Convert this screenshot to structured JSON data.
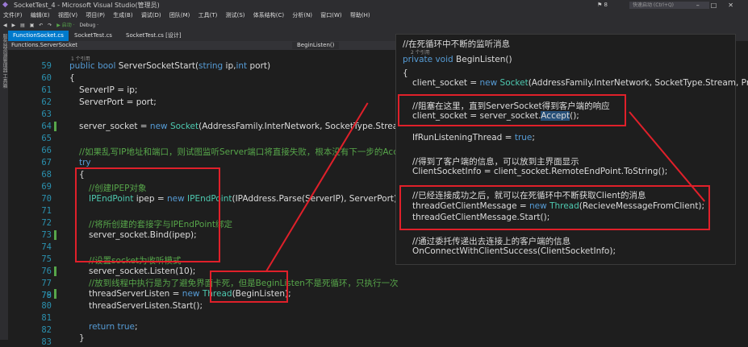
{
  "titlebar": {
    "title": "SocketTest_4 - Microsoft Visual Studio(管理员)",
    "quick_launch": "快速启动 (Ctrl+Q)",
    "notifications": "8"
  },
  "menu": [
    "文件(F)",
    "编辑(E)",
    "视图(V)",
    "项目(P)",
    "生成(B)",
    "调试(D)",
    "团队(M)",
    "工具(T)",
    "测试(S)",
    "体系结构(C)",
    "分析(N)",
    "窗口(W)",
    "帮助(H)"
  ],
  "toolbar": {
    "start": "▶ 启动 ·",
    "config": "Debug ·"
  },
  "side_panel": "服务器资源管理器 工具箱",
  "tabs": [
    "FunctionSocket.cs",
    "SocketTest.cs",
    "SocketTest.cs [设计]"
  ],
  "navbar": {
    "left": "Functions.ServerSocket",
    "right": "BeginListen()"
  },
  "editor": {
    "refs": "1 个引用",
    "lines": [
      {
        "n": "59",
        "k": "public",
        "k2": "bool",
        "rest": " ServerSocketStart(",
        "t": "string",
        "rest2": " ip,",
        "t2": "int",
        "rest3": " port)"
      },
      {
        "n": "60",
        "text": "{"
      },
      {
        "n": "61",
        "text": "ServerIP = ip;"
      },
      {
        "n": "62",
        "text": "ServerPort = port;"
      },
      {
        "n": "63",
        "text": ""
      },
      {
        "n": "64",
        "pre": "server_socket = ",
        "k": "new",
        "t": " Socket",
        "rest": "(AddressFamily.InterNetwork, SocketType.Stream, P"
      },
      {
        "n": "65",
        "text": ""
      },
      {
        "n": "66",
        "comment": "//如果乱写IP地址和端口，则试图监听Server端口将直接失败，根本没有下一步的Accep"
      },
      {
        "n": "67",
        "k": "try"
      },
      {
        "n": "68",
        "text": "{"
      },
      {
        "n": "69",
        "comment": "//创建IPEP对象"
      },
      {
        "n": "70",
        "t": "IPEndPoint",
        "rest": " ipep = ",
        "k": "new",
        "t2": " IPEndPoint",
        "rest2": "(IPAddress.Parse(ServerIP), ServerPort);"
      },
      {
        "n": "71",
        "text": ""
      },
      {
        "n": "72",
        "comment": "//将所创建的套接字与IPEndPoint绑定"
      },
      {
        "n": "73",
        "text": "server_socket.Bind(ipep);"
      },
      {
        "n": "74",
        "text": ""
      },
      {
        "n": "75",
        "comment": "//设置socket为收听模式"
      },
      {
        "n": "76",
        "text": "server_socket.Listen(10);"
      },
      {
        "n": "77",
        "text": ""
      },
      {
        "n": "78",
        "comment": "//放到线程中执行是为了避免界面卡死，但是BeginListen不是死循环，只执行一次"
      },
      {
        "n": "79",
        "pre": "threadServerListen = ",
        "k": "new",
        "t": " Thread",
        "rest": "(BeginListen);"
      },
      {
        "n": "80",
        "text": "threadServerListen.Start();"
      },
      {
        "n": "81",
        "text": ""
      },
      {
        "n": "82",
        "k": "return",
        "k2": " true",
        "rest": ";"
      },
      {
        "n": "83",
        "text": "}"
      }
    ]
  },
  "popup": {
    "comment0": "//在死循环中不断的监听消息",
    "refs": "2 个引用",
    "sig_k": "private",
    "sig_k2": " void",
    "sig_rest": " BeginListen()",
    "brace": "{",
    "l1_pre": "client_socket = ",
    "l1_k": "new",
    "l1_t": " Socket",
    "l1_rest": "(AddressFamily.InterNetwork, SocketType.Stream, Proto",
    "c2": "//阻塞在这里，直到ServerSocket得到客户端的响应",
    "l2_pre": "client_socket = server_socket.",
    "l2_sel": "Accept",
    "l2_rest": "();",
    "l3_pre": "IfRunListeningThread = ",
    "l3_k": "true",
    "l3_rest": ";",
    "c4": "//得到了客户端的信息，可以放到主界面显示",
    "l4": "ClientSocketInfo = client_socket.RemoteEndPoint.ToString();",
    "c5": "//已经连接成功之后，就可以在死循环中不断获取Client的消息",
    "l5_pre": "threadGetClientMessage = ",
    "l5_k": "new",
    "l5_t": " Thread",
    "l5_rest": "(RecieveMessageFromClient);",
    "l6": "threadGetClientMessage.Start();",
    "c7": "//通过委托传递出去连接上的客户端的信息",
    "l7": "OnConnectWithClientSuccess(ClientSocketInfo);"
  }
}
